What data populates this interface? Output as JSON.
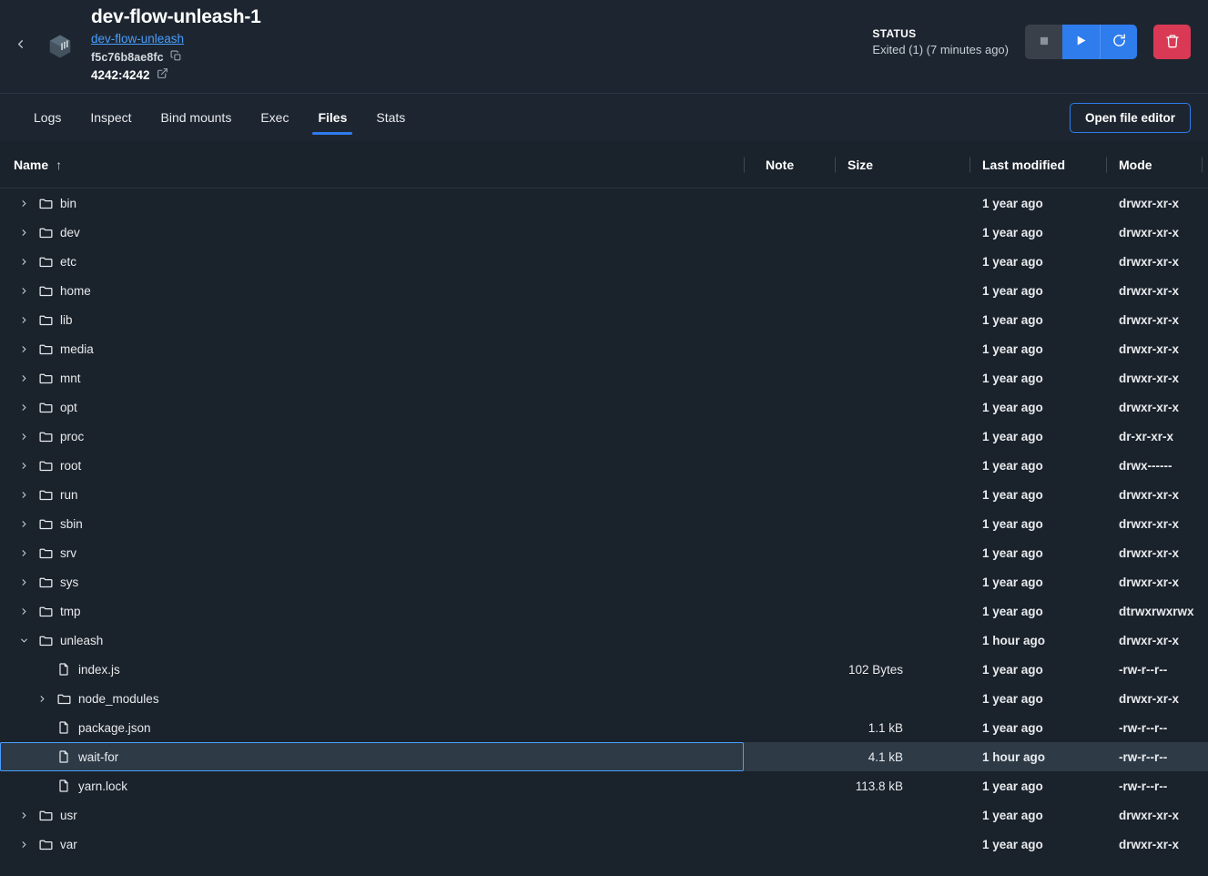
{
  "header": {
    "back_icon": "chevron-left-icon",
    "container_icon": "container-cube-icon",
    "title": "dev-flow-unleash-1",
    "image_link": "dev-flow-unleash",
    "container_id": "f5c76b8ae8fc",
    "copy_icon": "copy-icon",
    "port": "4242:4242",
    "external_link_icon": "external-link-icon",
    "status_label": "STATUS",
    "status_value": "Exited (1) (7 minutes ago)",
    "actions": {
      "stop_icon": "stop-square-icon",
      "start_icon": "play-triangle-icon",
      "restart_icon": "restart-circle-arrow-icon",
      "delete_icon": "trash-can-icon"
    }
  },
  "colors": {
    "accent": "#2f7ced",
    "link": "#4a9eff",
    "danger": "#d93954",
    "header_bg": "#1d2630",
    "body_bg": "#1a222b",
    "row_selected_bg": "#2e3b47"
  },
  "tabs": [
    {
      "label": "Logs",
      "active": false
    },
    {
      "label": "Inspect",
      "active": false
    },
    {
      "label": "Bind mounts",
      "active": false
    },
    {
      "label": "Exec",
      "active": false
    },
    {
      "label": "Files",
      "active": true
    },
    {
      "label": "Stats",
      "active": false
    }
  ],
  "toolbar": {
    "open_file_editor_label": "Open file editor"
  },
  "table": {
    "columns": {
      "name": "Name",
      "note": "Note",
      "size": "Size",
      "last_modified": "Last modified",
      "mode": "Mode"
    },
    "sort": {
      "column": "Name",
      "direction": "ascending",
      "arrow": "↑"
    },
    "rows": [
      {
        "name": "bin",
        "type": "folder",
        "depth": 0,
        "expanded": false,
        "note": "",
        "size": "",
        "modified": "1 year ago",
        "mode": "drwxr-xr-x",
        "selected": false
      },
      {
        "name": "dev",
        "type": "folder",
        "depth": 0,
        "expanded": false,
        "note": "",
        "size": "",
        "modified": "1 year ago",
        "mode": "drwxr-xr-x",
        "selected": false
      },
      {
        "name": "etc",
        "type": "folder",
        "depth": 0,
        "expanded": false,
        "note": "",
        "size": "",
        "modified": "1 year ago",
        "mode": "drwxr-xr-x",
        "selected": false
      },
      {
        "name": "home",
        "type": "folder",
        "depth": 0,
        "expanded": false,
        "note": "",
        "size": "",
        "modified": "1 year ago",
        "mode": "drwxr-xr-x",
        "selected": false
      },
      {
        "name": "lib",
        "type": "folder",
        "depth": 0,
        "expanded": false,
        "note": "",
        "size": "",
        "modified": "1 year ago",
        "mode": "drwxr-xr-x",
        "selected": false
      },
      {
        "name": "media",
        "type": "folder",
        "depth": 0,
        "expanded": false,
        "note": "",
        "size": "",
        "modified": "1 year ago",
        "mode": "drwxr-xr-x",
        "selected": false
      },
      {
        "name": "mnt",
        "type": "folder",
        "depth": 0,
        "expanded": false,
        "note": "",
        "size": "",
        "modified": "1 year ago",
        "mode": "drwxr-xr-x",
        "selected": false
      },
      {
        "name": "opt",
        "type": "folder",
        "depth": 0,
        "expanded": false,
        "note": "",
        "size": "",
        "modified": "1 year ago",
        "mode": "drwxr-xr-x",
        "selected": false
      },
      {
        "name": "proc",
        "type": "folder",
        "depth": 0,
        "expanded": false,
        "note": "",
        "size": "",
        "modified": "1 year ago",
        "mode": "dr-xr-xr-x",
        "selected": false
      },
      {
        "name": "root",
        "type": "folder",
        "depth": 0,
        "expanded": false,
        "note": "",
        "size": "",
        "modified": "1 year ago",
        "mode": "drwx------",
        "selected": false
      },
      {
        "name": "run",
        "type": "folder",
        "depth": 0,
        "expanded": false,
        "note": "",
        "size": "",
        "modified": "1 year ago",
        "mode": "drwxr-xr-x",
        "selected": false
      },
      {
        "name": "sbin",
        "type": "folder",
        "depth": 0,
        "expanded": false,
        "note": "",
        "size": "",
        "modified": "1 year ago",
        "mode": "drwxr-xr-x",
        "selected": false
      },
      {
        "name": "srv",
        "type": "folder",
        "depth": 0,
        "expanded": false,
        "note": "",
        "size": "",
        "modified": "1 year ago",
        "mode": "drwxr-xr-x",
        "selected": false
      },
      {
        "name": "sys",
        "type": "folder",
        "depth": 0,
        "expanded": false,
        "note": "",
        "size": "",
        "modified": "1 year ago",
        "mode": "drwxr-xr-x",
        "selected": false
      },
      {
        "name": "tmp",
        "type": "folder",
        "depth": 0,
        "expanded": false,
        "note": "",
        "size": "",
        "modified": "1 year ago",
        "mode": "dtrwxrwxrwx",
        "selected": false
      },
      {
        "name": "unleash",
        "type": "folder",
        "depth": 0,
        "expanded": true,
        "note": "",
        "size": "",
        "modified": "1 hour ago",
        "mode": "drwxr-xr-x",
        "selected": false
      },
      {
        "name": "index.js",
        "type": "file",
        "depth": 1,
        "expanded": false,
        "note": "",
        "size": "102 Bytes",
        "modified": "1 year ago",
        "mode": "-rw-r--r--",
        "selected": false
      },
      {
        "name": "node_modules",
        "type": "folder",
        "depth": 1,
        "expanded": false,
        "note": "",
        "size": "",
        "modified": "1 year ago",
        "mode": "drwxr-xr-x",
        "selected": false
      },
      {
        "name": "package.json",
        "type": "file",
        "depth": 1,
        "expanded": false,
        "note": "",
        "size": "1.1 kB",
        "modified": "1 year ago",
        "mode": "-rw-r--r--",
        "selected": false
      },
      {
        "name": "wait-for",
        "type": "file",
        "depth": 1,
        "expanded": false,
        "note": "",
        "size": "4.1 kB",
        "modified": "1 hour ago",
        "mode": "-rw-r--r--",
        "selected": true
      },
      {
        "name": "yarn.lock",
        "type": "file",
        "depth": 1,
        "expanded": false,
        "note": "",
        "size": "113.8 kB",
        "modified": "1 year ago",
        "mode": "-rw-r--r--",
        "selected": false
      },
      {
        "name": "usr",
        "type": "folder",
        "depth": 0,
        "expanded": false,
        "note": "",
        "size": "",
        "modified": "1 year ago",
        "mode": "drwxr-xr-x",
        "selected": false
      },
      {
        "name": "var",
        "type": "folder",
        "depth": 0,
        "expanded": false,
        "note": "",
        "size": "",
        "modified": "1 year ago",
        "mode": "drwxr-xr-x",
        "selected": false
      }
    ]
  }
}
